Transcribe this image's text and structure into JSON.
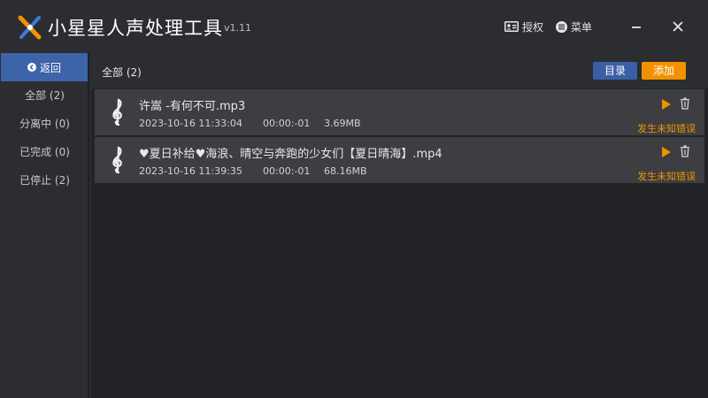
{
  "app": {
    "title": "小星星人声处理工具",
    "version": "v1.11"
  },
  "toolbar": {
    "auth_label": "授权",
    "menu_label": "菜单"
  },
  "sidebar": {
    "back_label": "返回",
    "items": [
      {
        "label": "全部 (2)"
      },
      {
        "label": "分离中 (0)"
      },
      {
        "label": "已完成 (0)"
      },
      {
        "label": "已停止 (2)"
      }
    ]
  },
  "main": {
    "filter_label": "全部 (2)",
    "dir_button": "目录",
    "add_button": "添加",
    "files": [
      {
        "name": "许嵩 -有何不可.mp3",
        "date": "2023-10-16 11:33:04",
        "duration": "00:00:-01",
        "size": "3.69MB",
        "status": "发生未知错误"
      },
      {
        "name": "♥夏日补给♥海浪、晴空与奔跑的少女们【夏日晴海】.mp4",
        "date": "2023-10-16 11:39:35",
        "duration": "00:00:-01",
        "size": "68.16MB",
        "status": "发生未知错误"
      }
    ]
  },
  "colors": {
    "accent_orange": "#f39200",
    "accent_blue": "#3d63a8",
    "row_bg": "#3c3e42",
    "background": "#222326"
  },
  "icons": [
    "app-logo-icon",
    "id-card-icon",
    "menu-icon",
    "minimize-icon",
    "close-icon",
    "back-arrow-icon",
    "treble-clef-icon",
    "play-icon",
    "trash-icon"
  ]
}
